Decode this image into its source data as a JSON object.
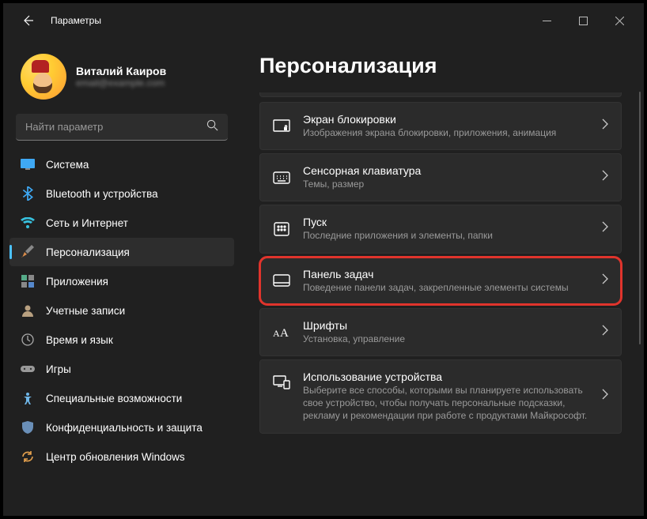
{
  "window": {
    "title": "Параметры"
  },
  "profile": {
    "name": "Виталий Каиров",
    "sub": "email@example.com"
  },
  "search": {
    "placeholder": "Найти параметр"
  },
  "nav": {
    "items": [
      {
        "label": "Система"
      },
      {
        "label": "Bluetooth и устройства"
      },
      {
        "label": "Сеть и Интернет"
      },
      {
        "label": "Персонализация"
      },
      {
        "label": "Приложения"
      },
      {
        "label": "Учетные записи"
      },
      {
        "label": "Время и язык"
      },
      {
        "label": "Игры"
      },
      {
        "label": "Специальные возможности"
      },
      {
        "label": "Конфиденциальность и защита"
      },
      {
        "label": "Центр обновления Windows"
      }
    ]
  },
  "page": {
    "title": "Персонализация"
  },
  "cards": [
    {
      "title": "Экран блокировки",
      "sub": "Изображения экрана блокировки, приложения, анимация"
    },
    {
      "title": "Сенсорная клавиатура",
      "sub": "Темы, размер"
    },
    {
      "title": "Пуск",
      "sub": "Последние приложения и элементы, папки"
    },
    {
      "title": "Панель задач",
      "sub": "Поведение панели задач, закрепленные элементы системы"
    },
    {
      "title": "Шрифты",
      "sub": "Установка, управление"
    },
    {
      "title": "Использование устройства",
      "sub": "Выберите все способы, которыми вы планируете использовать свое устройство, чтобы получать персональные подсказки, рекламу и рекомендации при работе с продуктами Майкрософт."
    }
  ]
}
